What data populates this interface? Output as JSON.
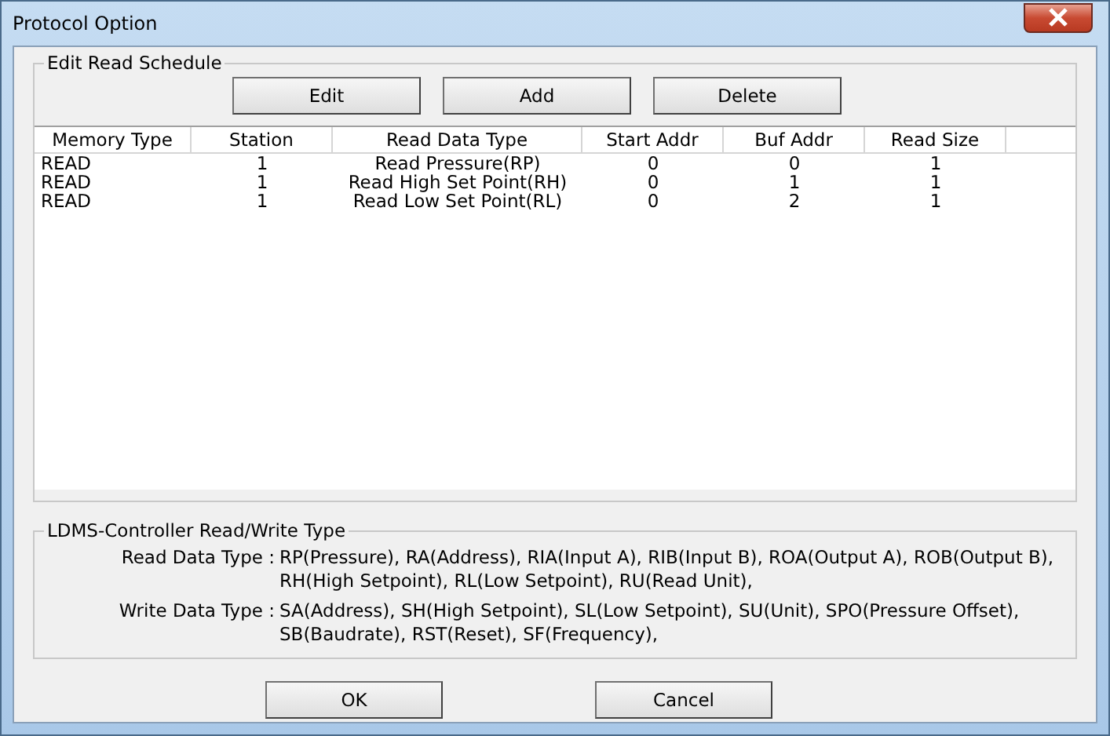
{
  "window": {
    "title": "Protocol Option"
  },
  "schedule": {
    "title": "Edit Read Schedule",
    "buttons": [
      "Edit",
      "Add",
      "Delete"
    ],
    "columns": [
      "Memory Type",
      "Station",
      "Read Data Type",
      "Start Addr",
      "Buf Addr",
      "Read Size"
    ],
    "rows": [
      [
        "READ",
        "1",
        "Read Pressure(RP)",
        "0",
        "0",
        "1"
      ],
      [
        "READ",
        "1",
        "Read High Set Point(RH)",
        "0",
        "1",
        "1"
      ],
      [
        "READ",
        "1",
        "Read Low Set Point(RL)",
        "0",
        "2",
        "1"
      ]
    ]
  },
  "types": {
    "title": "LDMS-Controller Read/Write Type",
    "items": [
      {
        "label": "Read Data Type :",
        "lines": [
          "RP(Pressure), RA(Address), RIA(Input A), RIB(Input B), ROA(Output A), ROB(Output B),",
          "RH(High Setpoint), RL(Low Setpoint), RU(Read Unit),"
        ]
      },
      {
        "label": "Write Data Type :",
        "lines": [
          "SA(Address), SH(High Setpoint), SL(Low Setpoint), SU(Unit), SPO(Pressure Offset),",
          "SB(Baudrate), RST(Reset), SF(Frequency),"
        ]
      }
    ]
  },
  "buttons": [
    "OK",
    "Cancel"
  ]
}
